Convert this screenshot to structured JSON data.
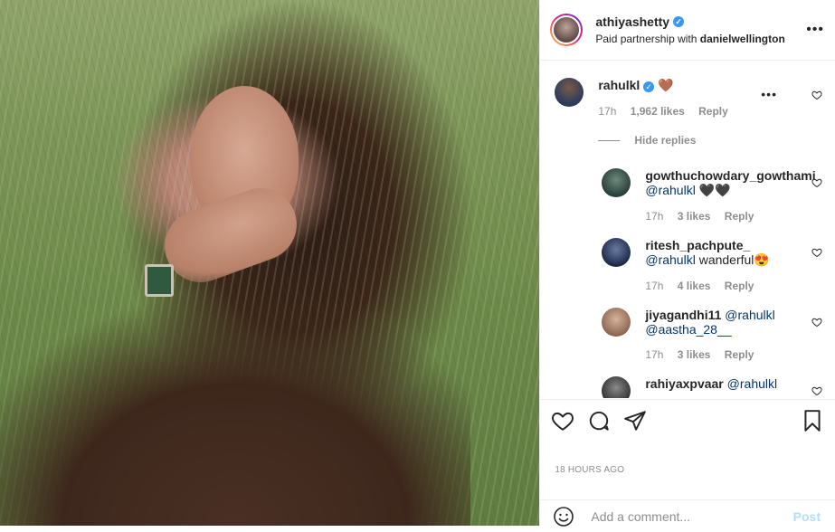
{
  "post": {
    "username": "athiyashetty",
    "partnership_prefix": "Paid partnership with",
    "partner": "danielwellington",
    "more_label": "•••"
  },
  "comment": {
    "username": "rahulkl",
    "text": "🤎",
    "time": "17h",
    "likes": "1,962 likes",
    "reply": "Reply",
    "more": "•••"
  },
  "hide_replies": "Hide replies",
  "replies": [
    {
      "username": "gowthuchowdary_gowthami",
      "mention": "@rahulkl",
      "text": " 🖤🖤",
      "time": "17h",
      "likes": "3 likes",
      "reply": "Reply"
    },
    {
      "username": "ritesh_pachpute_",
      "mention": "@rahulkl",
      "text": " wanderful😍",
      "time": "17h",
      "likes": "4 likes",
      "reply": "Reply"
    },
    {
      "username": "jiyagandhi11",
      "mention": "@rahulkl",
      "mention2": "@aastha_28__",
      "time": "17h",
      "likes": "3 likes",
      "reply": "Reply"
    },
    {
      "username": "rahiyaxpvaar",
      "mention": "@rahulkl"
    }
  ],
  "timestamp": "18 HOURS AGO",
  "add_comment": {
    "placeholder": "Add a comment...",
    "post_label": "Post"
  },
  "colors": {
    "accent": "#3897f0",
    "muted": "#8e8e8e",
    "post_disabled": "#b2dffc"
  }
}
